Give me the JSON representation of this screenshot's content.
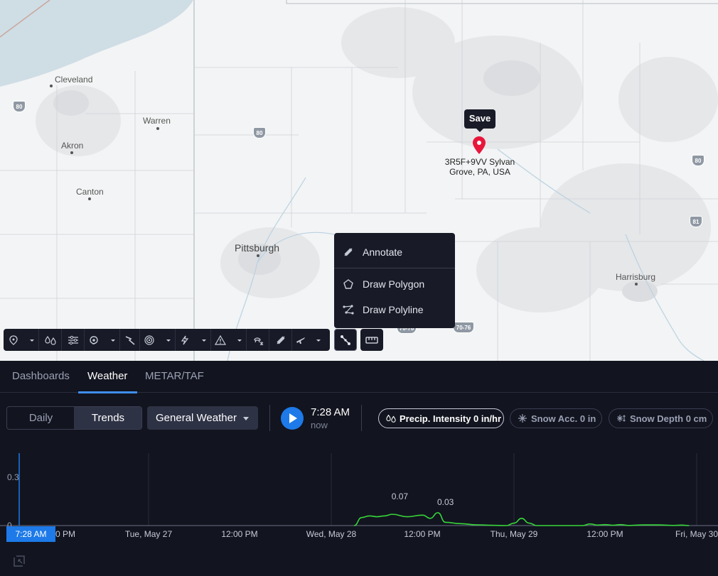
{
  "map": {
    "cities": [
      {
        "name": "Cleveland",
        "big": false
      },
      {
        "name": "Warren",
        "big": false
      },
      {
        "name": "Akron",
        "big": false
      },
      {
        "name": "Canton",
        "big": false
      },
      {
        "name": "Pittsburgh",
        "big": true
      },
      {
        "name": "Harrisburg",
        "big": false
      }
    ],
    "shields": [
      "80",
      "80",
      "80",
      "81",
      "70-76",
      "70-76"
    ],
    "save_tooltip": "Save",
    "pin_label_line1": "3R5F+9VV Sylvan",
    "pin_label_line2": "Grove, PA, USA",
    "pin_color": "#e8163c"
  },
  "draw_menu": {
    "items": [
      {
        "label": "Annotate",
        "icon": "annotate-icon"
      },
      {
        "label": "Draw Polygon",
        "icon": "polygon-icon"
      },
      {
        "label": "Draw Polyline",
        "icon": "polyline-icon"
      }
    ]
  },
  "toolbar": {
    "buttons": [
      "location-pin-icon",
      "precipitation-icon",
      "wind-icon",
      "hurricane-icon",
      "lightning-path-icon",
      "radar-icon",
      "lightning-icon",
      "warning-icon",
      "winter-icon",
      "annotate-icon",
      "airplane-icon"
    ],
    "draw_button_icon": "polyline-icon",
    "ruler_button_icon": "ruler-icon"
  },
  "tabs": [
    {
      "label": "Dashboards",
      "active": false
    },
    {
      "label": "Weather",
      "active": true
    },
    {
      "label": "METAR/TAF",
      "active": false
    }
  ],
  "controls": {
    "segment": {
      "daily": "Daily",
      "trends": "Trends",
      "selected": "Trends"
    },
    "layer_select": "General Weather",
    "time": "7:28 AM",
    "time_sub": "now",
    "pills": [
      {
        "label": "Precip. Intensity 0 in/hr",
        "icon": "precipitation-icon",
        "active": true
      },
      {
        "label": "Snow Acc. 0 in",
        "icon": "snow-acc-icon",
        "active": false
      },
      {
        "label": "Snow Depth 0 cm",
        "icon": "snow-depth-icon",
        "active": false
      }
    ],
    "accent_color": "#1d7ae8"
  },
  "chart_data": {
    "type": "line",
    "series": [
      {
        "color": "#37d63a",
        "points": [
          [
            "Wed, May 28 03:00",
            0
          ],
          [
            "Wed, May 28 04:00",
            0.05
          ],
          [
            "Wed, May 28 05:00",
            0.06
          ],
          [
            "Wed, May 28 06:00",
            0.055
          ],
          [
            "Wed, May 28 07:00",
            0.06
          ],
          [
            "Wed, May 28 08:00",
            0.07
          ],
          [
            "Wed, May 28 10:00",
            0.055
          ],
          [
            "Wed, May 28 12:00",
            0.065
          ],
          [
            "Wed, May 28 13:00",
            0.045
          ],
          [
            "Wed, May 28 14:00",
            0.08
          ],
          [
            "Wed, May 28 15:00",
            0.02
          ],
          [
            "Wed, May 28 17:00",
            0.012
          ],
          [
            "Wed, May 28 19:00",
            0.005
          ],
          [
            "Wed, May 28 21:00",
            0.002
          ],
          [
            "Wed, May 28 23:00",
            0
          ],
          [
            "Thu, May 29 00:00",
            0.015
          ],
          [
            "Thu, May 29 01:00",
            0.045
          ],
          [
            "Thu, May 29 02:00",
            0.015
          ],
          [
            "Thu, May 29 03:00",
            0
          ],
          [
            "Thu, May 29 09:00",
            0
          ],
          [
            "Thu, May 29 10:00",
            0.01
          ],
          [
            "Thu, May 29 11:00",
            0.003
          ],
          [
            "Thu, May 29 12:00",
            0.006
          ],
          [
            "Thu, May 29 13:00",
            0.002
          ],
          [
            "Thu, May 29 14:00",
            0.006
          ],
          [
            "Thu, May 29 15:00",
            0.001
          ],
          [
            "Thu, May 29 17:00",
            0.004
          ],
          [
            "Thu, May 29 19:00",
            0.004
          ],
          [
            "Thu, May 29 21:00",
            0.001
          ],
          [
            "Thu, May 29 22:00",
            0.003
          ],
          [
            "Thu, May 29 23:00",
            0
          ]
        ]
      }
    ],
    "data_labels": [
      {
        "text": "0.07",
        "at": "Wed, May 28 09:00",
        "value": 0.07
      },
      {
        "text": "0.03",
        "at": "Wed, May 28 15:00",
        "value": 0.03
      }
    ],
    "y_ticks": [
      "0.3",
      "0"
    ],
    "x_ticks": [
      "0 PM",
      "Tue, May 27",
      "12:00 PM",
      "Wed, May 28",
      "12:00 PM",
      "Thu, May 29",
      "12:00 PM",
      "Fri, May 30"
    ],
    "now_label": "7:28 AM",
    "grid": true
  }
}
